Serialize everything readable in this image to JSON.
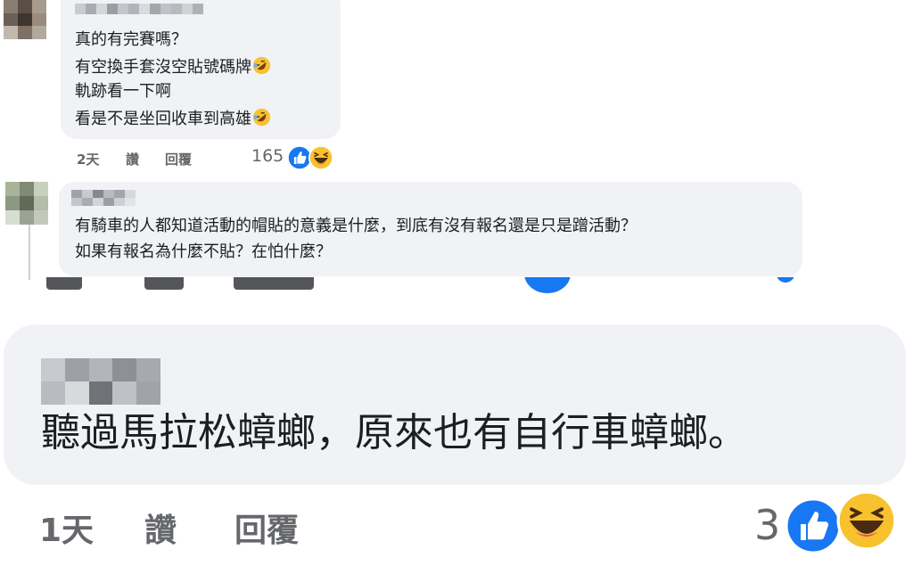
{
  "comments": [
    {
      "lines": [
        "真的有完賽嗎？",
        "有空換手套沒空貼號碼牌",
        "軌跡看一下啊",
        "看是不是坐回收車到高雄"
      ],
      "emoji_after_lines": [
        1,
        3
      ],
      "time": "2天",
      "like_label": "讚",
      "reply_label": "回覆",
      "reaction_count": "165",
      "reactions": [
        "like-icon",
        "haha-icon"
      ]
    },
    {
      "lines": [
        "有騎車的人都知道活動的帽貼的意義是什麼，到底有沒有報名還是只是蹭活動？",
        "如果有報名為什麼不貼？在怕什麼？"
      ]
    },
    {
      "lines": [
        "聽過馬拉松蟑螂，原來也有自行車蟑螂。"
      ],
      "time": "1天",
      "like_label": "讚",
      "reply_label": "回覆",
      "reaction_count": "3",
      "reactions": [
        "like-icon",
        "haha-icon"
      ]
    }
  ],
  "colors": {
    "bubble": "#f0f2f5",
    "text": "#1c1e21",
    "meta": "#65676b",
    "like_blue": "#1877f2",
    "haha_yellow": "#f7c22e"
  }
}
